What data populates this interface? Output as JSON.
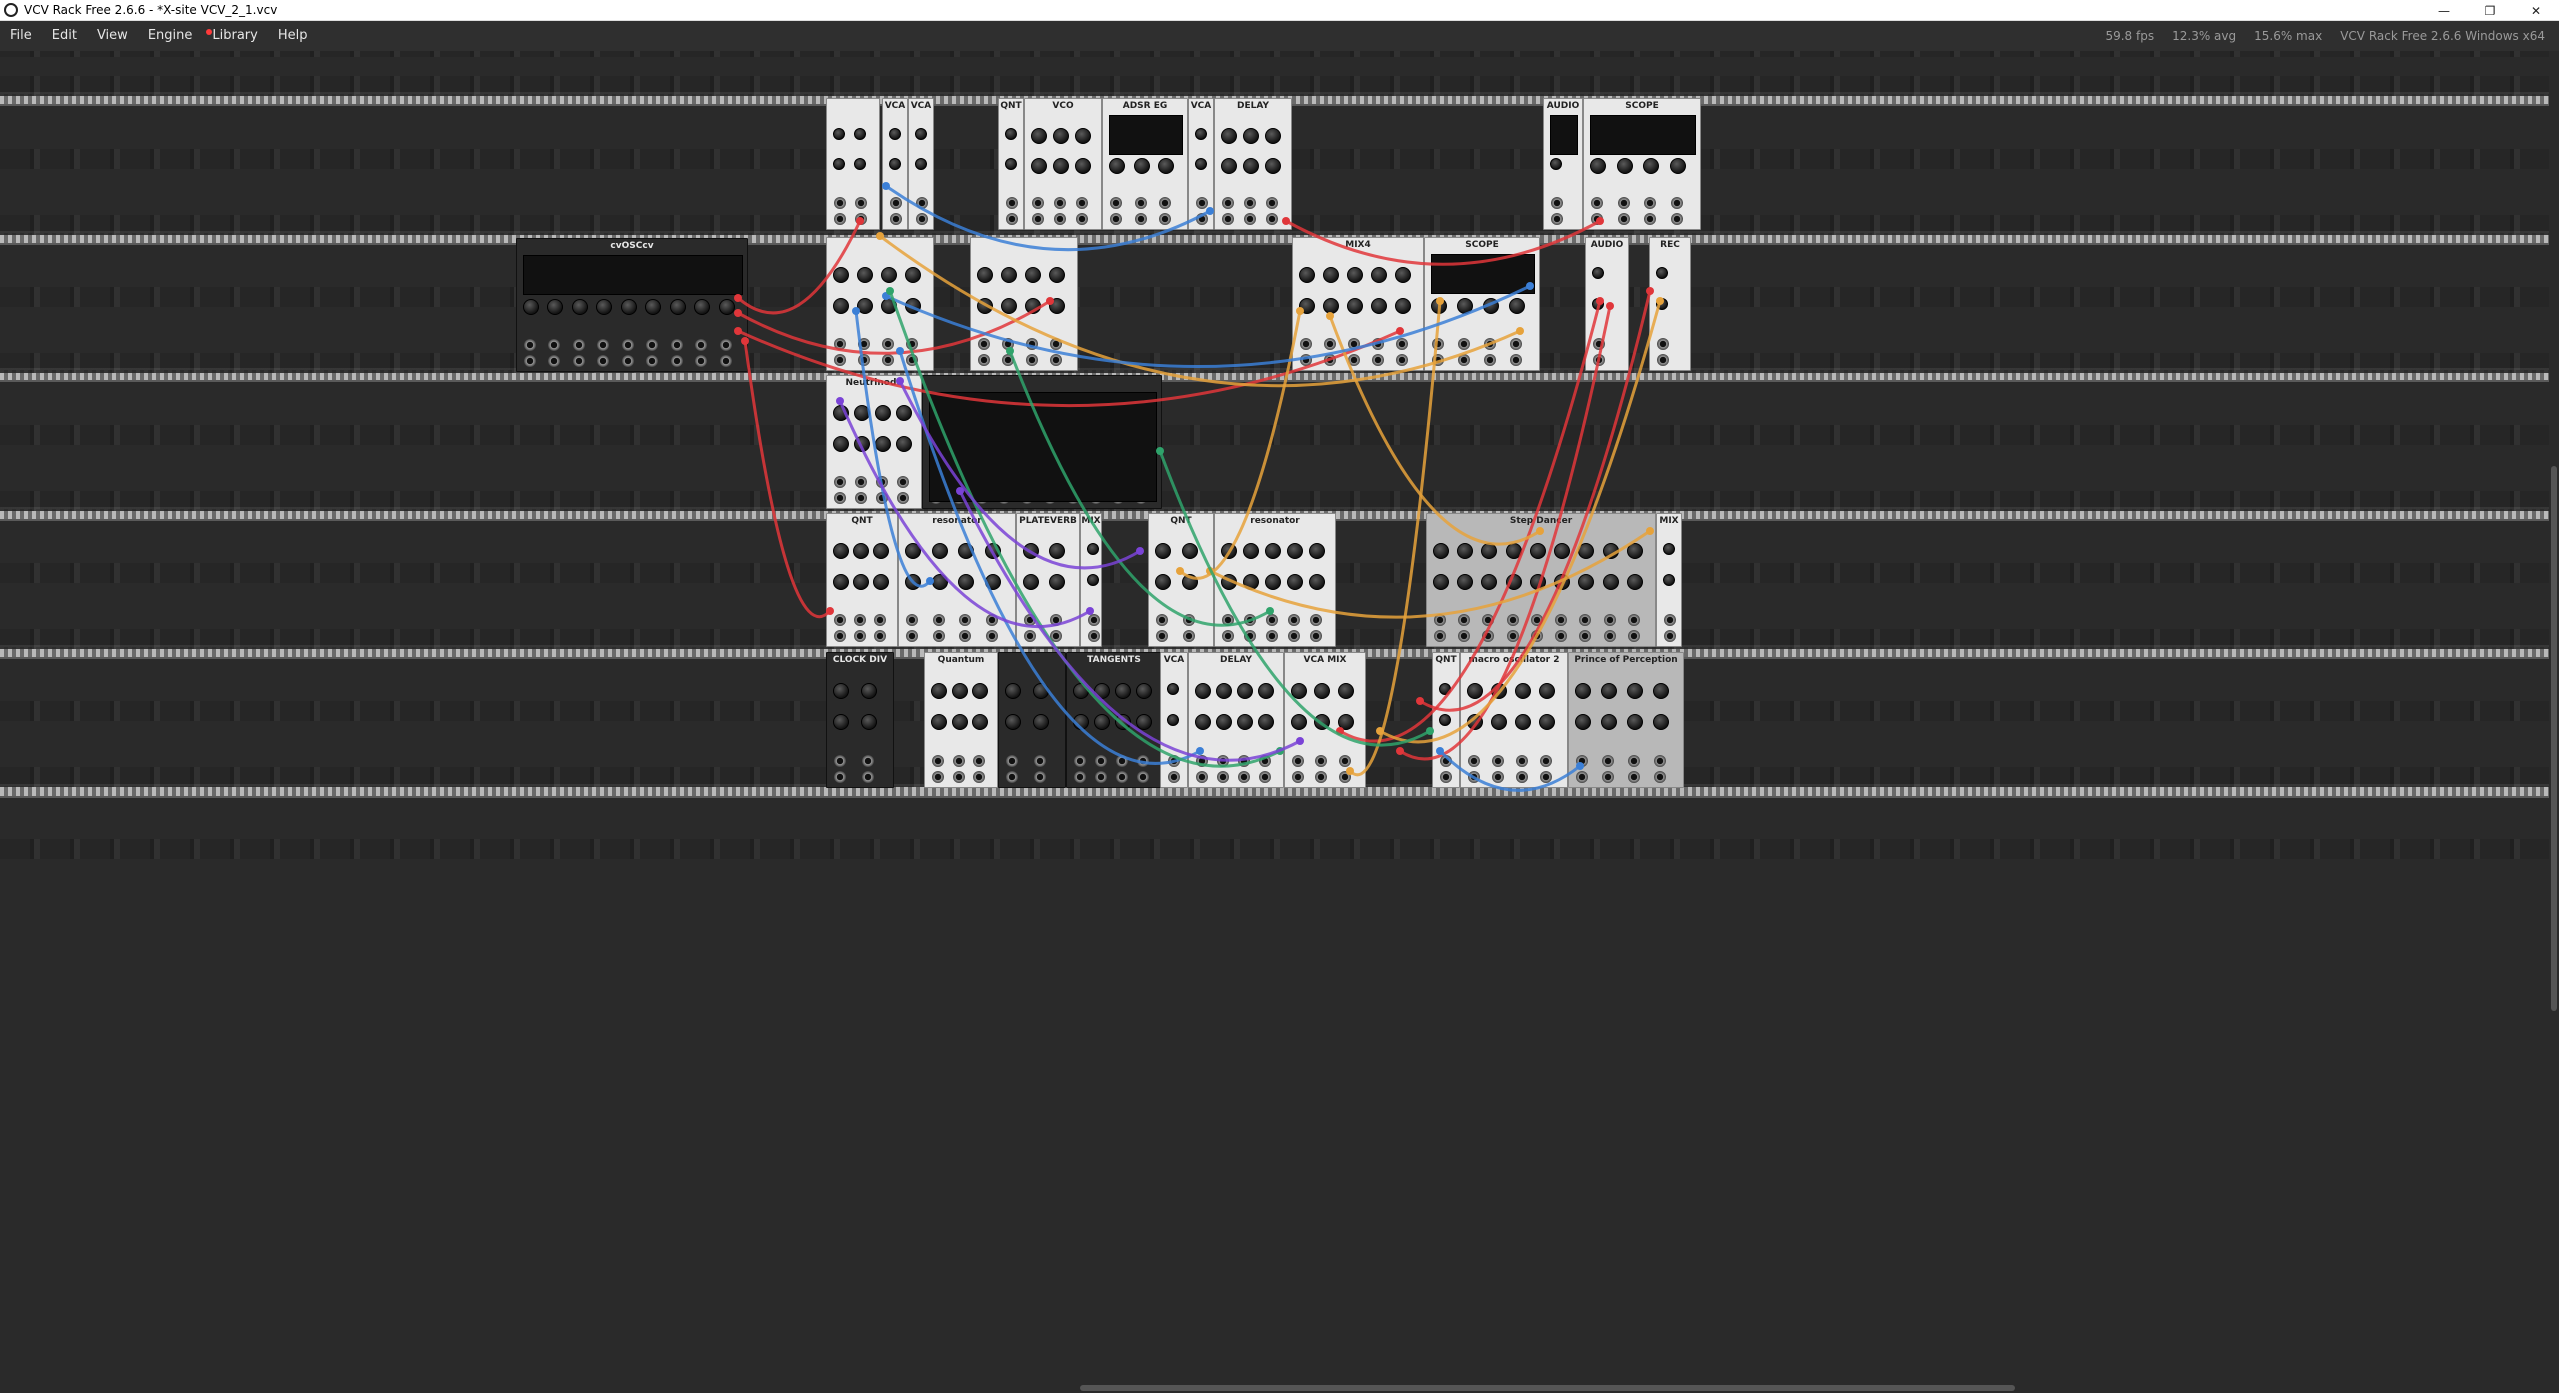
{
  "window": {
    "title": "VCV Rack Free 2.6.6 - *X-site VCV_2_1.vcv",
    "buttons": [
      "—",
      "❐",
      "✕"
    ]
  },
  "menubar": {
    "items": [
      "File",
      "Edit",
      "View",
      "Engine",
      "Library",
      "Help"
    ],
    "library_has_update": true,
    "fps": "59.8 fps",
    "avg": "12.3% avg",
    "max": "15.6% max",
    "version": "VCV Rack Free 2.6.6 Windows x64"
  },
  "modules": [
    {
      "id": "m1",
      "name": "",
      "style": "light"
    },
    {
      "id": "m2",
      "name": "VCA",
      "style": "light"
    },
    {
      "id": "m3",
      "name": "VCA",
      "style": "light"
    },
    {
      "id": "m4",
      "name": "QNT",
      "style": "light"
    },
    {
      "id": "m5",
      "name": "VCO",
      "style": "light"
    },
    {
      "id": "m6",
      "name": "ADSR EG",
      "style": "light"
    },
    {
      "id": "m7",
      "name": "VCA",
      "style": "light"
    },
    {
      "id": "m8",
      "name": "DELAY",
      "style": "light"
    },
    {
      "id": "m9",
      "name": "AUDIO",
      "style": "light"
    },
    {
      "id": "m10",
      "name": "SCOPE",
      "style": "light"
    },
    {
      "id": "m11",
      "name": "cvOSCcv",
      "style": "dark"
    },
    {
      "id": "m12",
      "name": "",
      "style": "light"
    },
    {
      "id": "m13",
      "name": "",
      "style": "light"
    },
    {
      "id": "m14",
      "name": "MIX4",
      "style": "light"
    },
    {
      "id": "m15",
      "name": "SCOPE",
      "style": "light"
    },
    {
      "id": "m16",
      "name": "AUDIO",
      "style": "light"
    },
    {
      "id": "m17",
      "name": "REC",
      "style": "light"
    },
    {
      "id": "m18",
      "name": "Neutrinode",
      "style": "light"
    },
    {
      "id": "m19",
      "name": "",
      "style": "dark"
    },
    {
      "id": "m20",
      "name": "QNT",
      "style": "light"
    },
    {
      "id": "m21",
      "name": "resonator",
      "style": "light"
    },
    {
      "id": "m22",
      "name": "PLATEVERB",
      "style": "light"
    },
    {
      "id": "m23",
      "name": "MIX",
      "style": "light"
    },
    {
      "id": "m24",
      "name": "QNT",
      "style": "light"
    },
    {
      "id": "m25",
      "name": "resonator",
      "style": "light"
    },
    {
      "id": "m26",
      "name": "Step Dancer",
      "style": "grey"
    },
    {
      "id": "m27",
      "name": "MIX",
      "style": "light"
    },
    {
      "id": "m28",
      "name": "CLOCK DIV",
      "style": "dark"
    },
    {
      "id": "m29",
      "name": "Quantum",
      "style": "light"
    },
    {
      "id": "m30",
      "name": "",
      "style": "dark"
    },
    {
      "id": "m31",
      "name": "TANGENTS",
      "style": "dark"
    },
    {
      "id": "m32",
      "name": "VCA",
      "style": "light"
    },
    {
      "id": "m33",
      "name": "DELAY",
      "style": "light"
    },
    {
      "id": "m34",
      "name": "VCA MIX",
      "style": "light"
    },
    {
      "id": "m35",
      "name": "QNT",
      "style": "light"
    },
    {
      "id": "m36",
      "name": "macro oscillator 2",
      "style": "light"
    },
    {
      "id": "m37",
      "name": "Prince of Perception",
      "style": "grey"
    }
  ],
  "colors": {
    "cable_red": "#e0363a",
    "cable_orange": "#e6a23b",
    "cable_blue": "#3b7fd6",
    "cable_green": "#2fa36b",
    "cable_purple": "#7a43d6"
  }
}
